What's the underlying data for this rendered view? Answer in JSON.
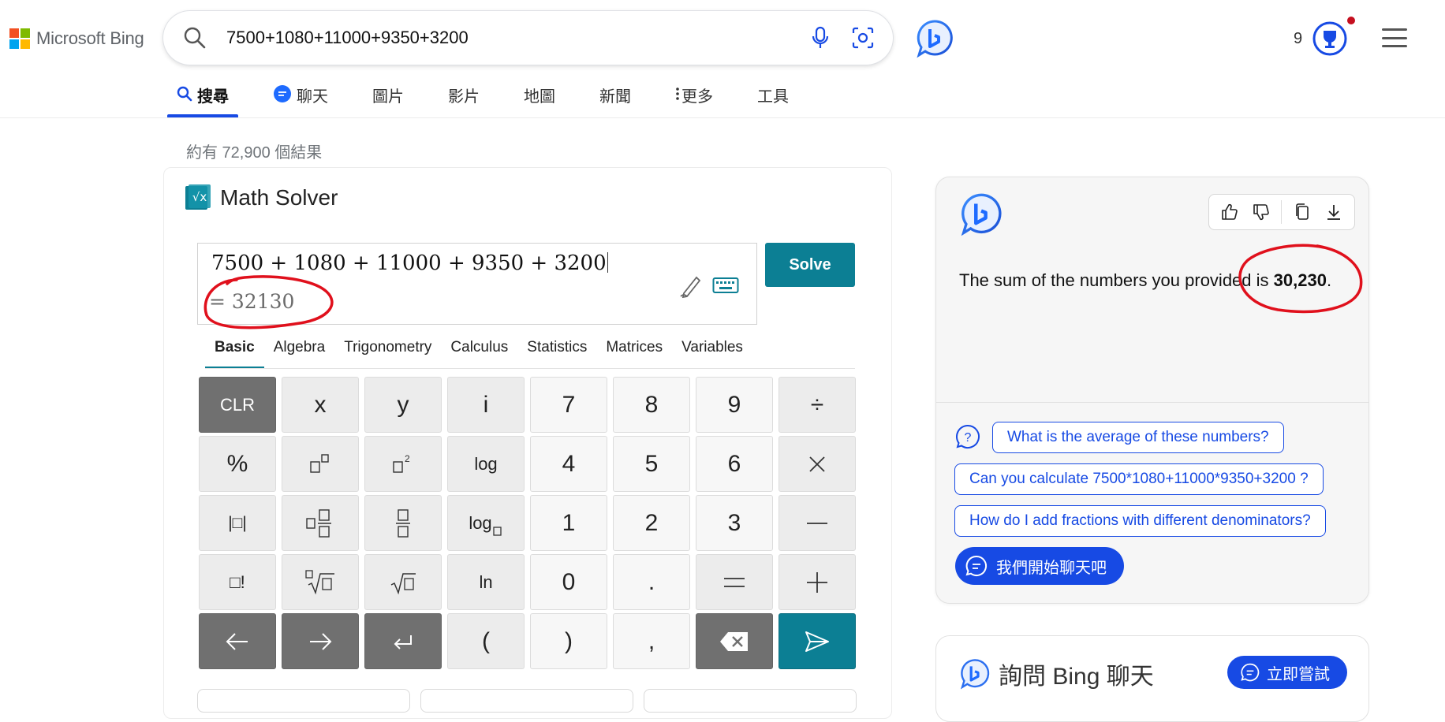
{
  "header": {
    "logo_text": "Microsoft Bing",
    "search_value": "7500+1080+11000+9350+3200",
    "rewards_count": "9"
  },
  "tabs": [
    {
      "label": "搜尋",
      "icon": "search-icon",
      "active": true
    },
    {
      "label": "聊天",
      "icon": "chat-icon",
      "active": false
    },
    {
      "label": "圖片",
      "active": false
    },
    {
      "label": "影片",
      "active": false
    },
    {
      "label": "地圖",
      "active": false
    },
    {
      "label": "新聞",
      "active": false
    },
    {
      "label": "更多",
      "icon": "more-vertical-icon",
      "active": false
    },
    {
      "label": "工具",
      "active": false
    }
  ],
  "result_count": "約有 72,900 個結果",
  "math_solver": {
    "title": "Math Solver",
    "expression": "7500 + 1080 + 11000 + 9350 + 3200",
    "result": "= 32130",
    "solve_label": "Solve",
    "tabs": [
      "Basic",
      "Algebra",
      "Trigonometry",
      "Calculus",
      "Statistics",
      "Matrices",
      "Variables"
    ],
    "active_tab": "Basic",
    "keys": {
      "clr": "CLR",
      "x": "x",
      "y": "y",
      "i": "i",
      "seven": "7",
      "eight": "8",
      "nine": "9",
      "divide": "÷",
      "percent": "%",
      "log": "log",
      "four": "4",
      "five": "5",
      "six": "6",
      "times": "×",
      "abs": "|□|",
      "log_base": "log",
      "one": "1",
      "two": "2",
      "three": "3",
      "minus": "−",
      "factorial": "□!",
      "ln": "ln",
      "zero": "0",
      "dot": ".",
      "equals": "=",
      "plus": "+",
      "open_paren": "(",
      "close_paren": ")",
      "comma": ","
    }
  },
  "copilot": {
    "answer_prefix": "The sum of the numbers you provided is ",
    "answer_value": "30,230",
    "answer_suffix": ".",
    "suggestions": [
      "What is the average of these numbers?",
      "Can you calculate 7500*1080+11000*9350+3200 ?",
      "How do I add fractions with different denominators?"
    ],
    "chat_button": "我們開始聊天吧",
    "ask_title": "詢問 Bing 聊天",
    "try_button": "立即嘗試"
  },
  "colors": {
    "accent_blue": "#174ae4",
    "teal": "#0c7f94",
    "annotation_red": "#e0101c"
  }
}
